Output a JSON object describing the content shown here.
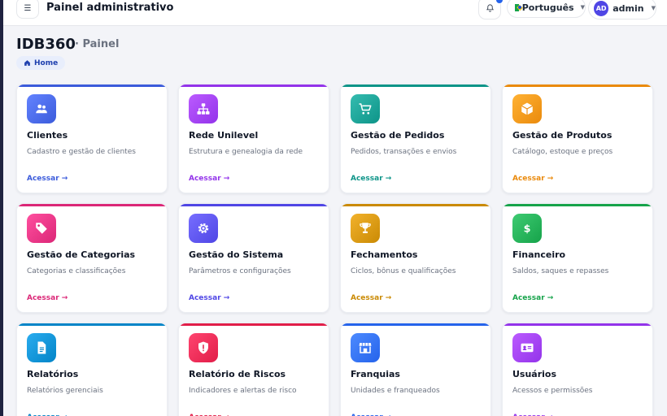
{
  "header": {
    "app_title": "Painel administrativo",
    "language": "Português",
    "user_initials": "AD",
    "user_name": "admin"
  },
  "page": {
    "title": "IDB360",
    "subtitle": "· Painel",
    "breadcrumb": "Home"
  },
  "cards": [
    {
      "title": "Clientes",
      "desc": "Cadastro e gestão de clientes",
      "link": "Acessar →",
      "color": "#3b5bdb",
      "icon": "users-icon"
    },
    {
      "title": "Rede Unilevel",
      "desc": "Estrutura e genealogia da rede",
      "link": "Acessar →",
      "color": "#9333ea",
      "icon": "network-icon"
    },
    {
      "title": "Gestão de Pedidos",
      "desc": "Pedidos, transações e envios",
      "link": "Acessar →",
      "color": "#0d9488",
      "icon": "cart-icon"
    },
    {
      "title": "Gestão de Produtos",
      "desc": "Catálogo, estoque e preços",
      "link": "Acessar →",
      "color": "#ea8a0c",
      "icon": "box-icon"
    },
    {
      "title": "Gestão de Categorias",
      "desc": "Categorias e classificações",
      "link": "Acessar →",
      "color": "#db2777",
      "icon": "tag-icon"
    },
    {
      "title": "Gestão do Sistema",
      "desc": "Parâmetros e configurações",
      "link": "Acessar →",
      "color": "#4f46e5",
      "icon": "gear-icon"
    },
    {
      "title": "Fechamentos",
      "desc": "Ciclos, bônus e qualificações",
      "link": "Acessar →",
      "color": "#ca8a04",
      "icon": "trophy-icon"
    },
    {
      "title": "Financeiro",
      "desc": "Saldos, saques e repasses",
      "link": "Acessar →",
      "color": "#16a34a",
      "icon": "dollar-icon"
    },
    {
      "title": "Relatórios",
      "desc": "Relatórios gerenciais",
      "link": "Acessar →",
      "color": "#0284c7",
      "icon": "document-icon"
    },
    {
      "title": "Relatório de Riscos",
      "desc": "Indicadores e alertas de risco",
      "link": "Acessar →",
      "color": "#e11d48",
      "icon": "shield-icon"
    },
    {
      "title": "Franquias",
      "desc": "Unidades e franqueados",
      "link": "Acessar →",
      "color": "#2563eb",
      "icon": "store-icon"
    },
    {
      "title": "Usuários",
      "desc": "Acessos e permissões",
      "link": "Acessar →",
      "color": "#9333ea",
      "icon": "id-card-icon"
    }
  ]
}
